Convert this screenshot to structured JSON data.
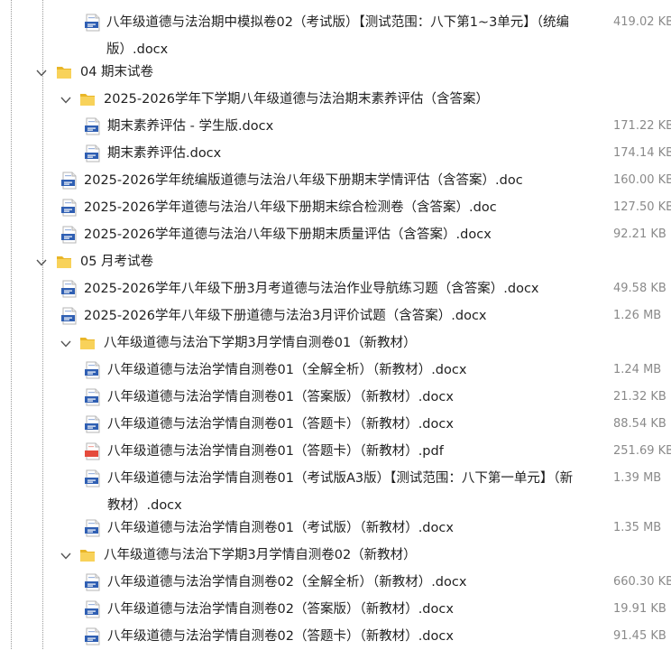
{
  "tree": {
    "items": [
      {
        "kind": "file",
        "icon": "word",
        "name": "八年级道德与法治期中模拟卷02（考试版）【测试范围：八下第1~3单元】（统编",
        "cont": "版）.docx",
        "size": "419.02 KB"
      },
      {
        "kind": "folder",
        "name": "04 期末试卷"
      },
      {
        "kind": "folder",
        "name": "2025-2026学年下学期八年级道德与法治期末素养评估（含答案）"
      },
      {
        "kind": "file",
        "icon": "word",
        "name": "期末素养评估 - 学生版.docx",
        "size": "171.22 KB"
      },
      {
        "kind": "file",
        "icon": "word",
        "name": "期末素养评估.docx",
        "size": "174.14 KB"
      },
      {
        "kind": "file",
        "icon": "word",
        "name": "2025-2026学年统编版道德与法治八年级下册期末学情评估（含答案）.doc",
        "size": "160.00 KB"
      },
      {
        "kind": "file",
        "icon": "word",
        "name": "2025-2026学年道德与法治八年级下册期末综合检测卷（含答案）.doc",
        "size": "127.50 KB"
      },
      {
        "kind": "file",
        "icon": "word",
        "name": "2025-2026学年道德与法治八年级下册期末质量评估（含答案）.docx",
        "size": "92.21 KB"
      },
      {
        "kind": "folder",
        "name": "05 月考试卷"
      },
      {
        "kind": "file",
        "icon": "word",
        "name": "2025-2026学年八年级下册3月考道德与法治作业导航练习题（含答案）.docx",
        "size": "49.58 KB"
      },
      {
        "kind": "file",
        "icon": "word",
        "name": "2025-2026学年八年级下册道德与法治3月评价试题（含答案）.docx",
        "size": "1.26 MB"
      },
      {
        "kind": "folder",
        "name": "八年级道德与法治下学期3月学情自测卷01（新教材）"
      },
      {
        "kind": "file",
        "icon": "word",
        "name": "八年级道德与法治学情自测卷01（全解全析）（新教材）.docx",
        "size": "1.24 MB"
      },
      {
        "kind": "file",
        "icon": "word",
        "name": "八年级道德与法治学情自测卷01（答案版）（新教材）.docx",
        "size": "21.32 KB"
      },
      {
        "kind": "file",
        "icon": "word",
        "name": "八年级道德与法治学情自测卷01（答题卡）（新教材）.docx",
        "size": "88.54 KB"
      },
      {
        "kind": "file",
        "icon": "pdf",
        "name": "八年级道德与法治学情自测卷01（答题卡）（新教材）.pdf",
        "size": "251.69 KB"
      },
      {
        "kind": "file",
        "icon": "word",
        "name": "八年级道德与法治学情自测卷01（考试版A3版）【测试范围：八下第一单元】（新",
        "cont": "教材）.docx",
        "size": "1.39 MB"
      },
      {
        "kind": "file",
        "icon": "word",
        "name": "八年级道德与法治学情自测卷01（考试版）（新教材）.docx",
        "size": "1.35 MB"
      },
      {
        "kind": "folder",
        "name": "八年级道德与法治下学期3月学情自测卷02（新教材）"
      },
      {
        "kind": "file",
        "icon": "word",
        "name": "八年级道德与法治学情自测卷02（全解全析）（新教材）.docx",
        "size": "660.30 KB"
      },
      {
        "kind": "file",
        "icon": "word",
        "name": "八年级道德与法治学情自测卷02（答案版）（新教材）.docx",
        "size": "19.91 KB"
      },
      {
        "kind": "file",
        "icon": "word",
        "name": "八年级道德与法治学情自测卷02（答题卡）（新教材）.docx",
        "size": "91.45 KB"
      }
    ]
  }
}
